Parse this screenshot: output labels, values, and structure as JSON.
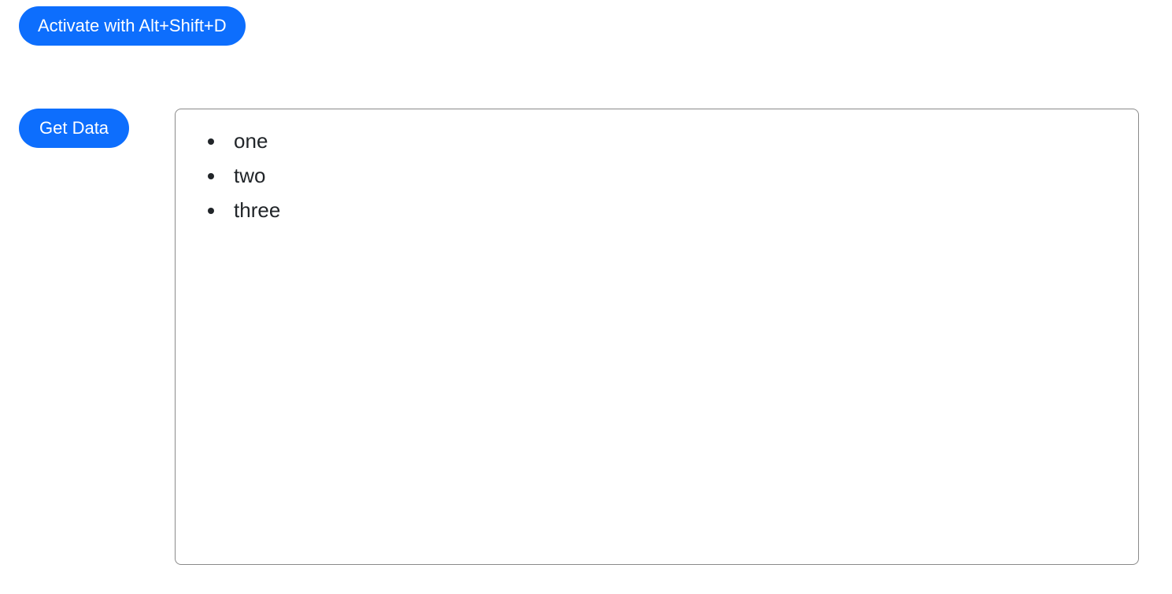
{
  "buttons": {
    "activate_label": "Activate with Alt+Shift+D",
    "get_data_label": "Get Data"
  },
  "results": {
    "items": [
      "one",
      "two",
      "three"
    ]
  }
}
